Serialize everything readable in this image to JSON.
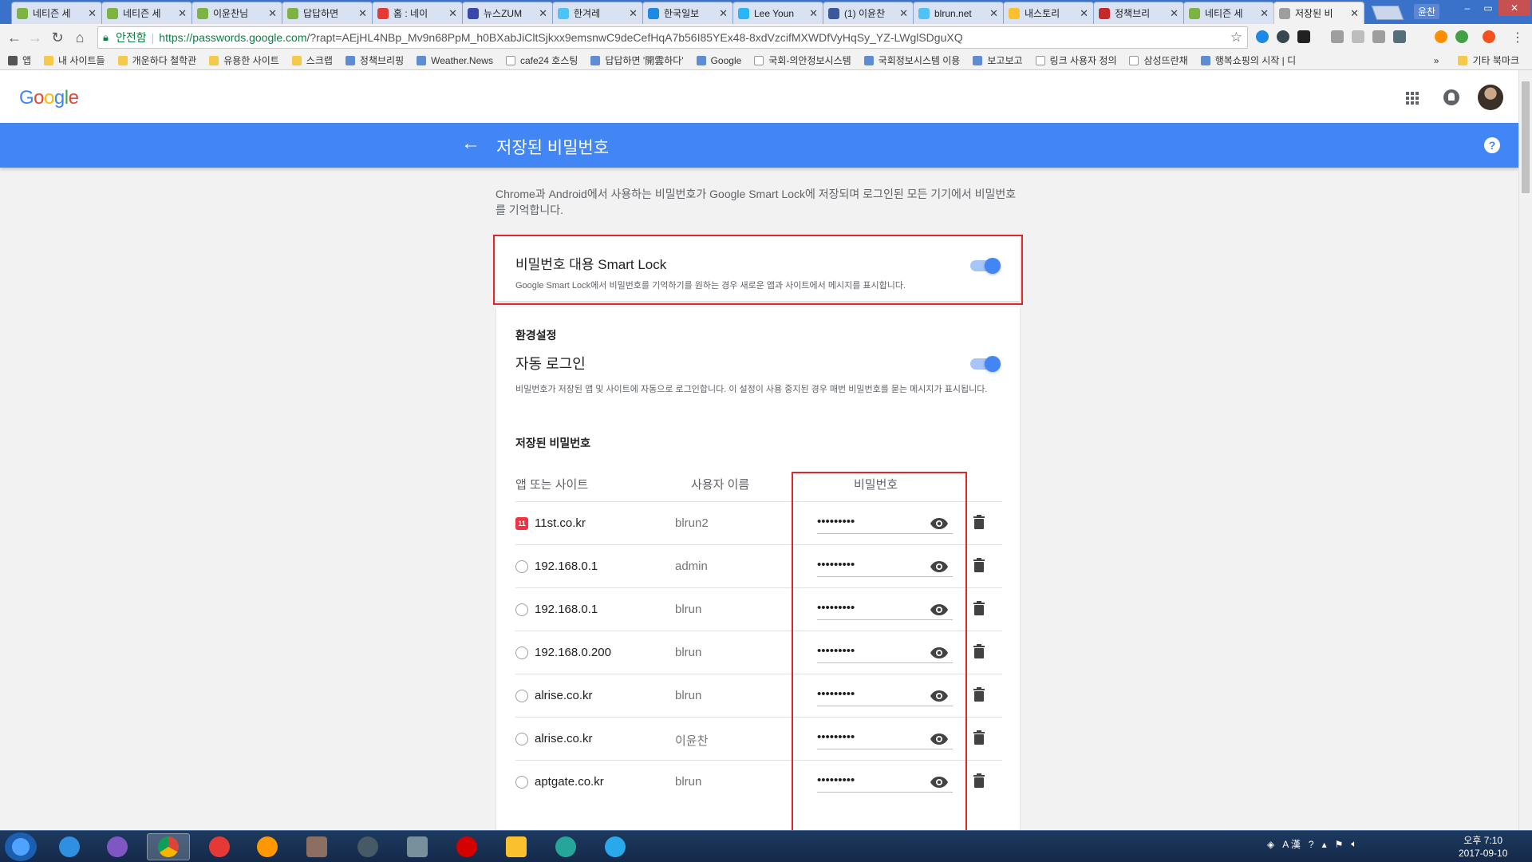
{
  "browser": {
    "tabs": [
      {
        "title": "네티즌 세",
        "icon_color": "#7cb342"
      },
      {
        "title": "네티즌 세",
        "icon_color": "#7cb342"
      },
      {
        "title": "이윤찬님",
        "icon_color": "#7cb342"
      },
      {
        "title": "답답하면",
        "icon_color": "#7cb342"
      },
      {
        "title": "홈 : 네이",
        "icon_color": "#e53935"
      },
      {
        "title": "뉴스ZUM",
        "icon_color": "#3949ab"
      },
      {
        "title": "한겨레",
        "icon_color": "#4fc3f7"
      },
      {
        "title": "한국일보",
        "icon_color": "#1e88e5"
      },
      {
        "title": "Lee Youn",
        "icon_color": "#29b6f6"
      },
      {
        "title": "(1) 이윤찬",
        "icon_color": "#3b5998"
      },
      {
        "title": "blrun.net",
        "icon_color": "#4fc3f7"
      },
      {
        "title": "내스토리",
        "icon_color": "#fbc02d"
      },
      {
        "title": "정책브리",
        "icon_color": "#c62828"
      },
      {
        "title": "네티즌 세",
        "icon_color": "#7cb342"
      },
      {
        "title": "저장된 비",
        "icon_color": "#9e9e9e"
      }
    ],
    "profile_name": "윤찬",
    "omnibox": {
      "security_label": "안전함",
      "url_host": "https://passwords.google.com",
      "url_path": "/?rapt=AEjHL4NBp_Mv9n68PpM_h0BXabJiCltSjkxx9emsnwC9deCefHqA7b56I85YEx48-8xdVzcifMXWDfVyHqSy_YZ-LWglSDguXQ"
    },
    "bookmarks": [
      {
        "label": "앱",
        "type": "apps"
      },
      {
        "label": "내 사이트들",
        "type": "folder"
      },
      {
        "label": "개운하다 철학관",
        "type": "folder"
      },
      {
        "label": "유용한 사이트",
        "type": "folder"
      },
      {
        "label": "스크랩",
        "type": "folder"
      },
      {
        "label": "정책브리핑",
        "type": "site"
      },
      {
        "label": "Weather.News",
        "type": "site"
      },
      {
        "label": "cafe24 호스팅",
        "type": "page"
      },
      {
        "label": "답답하면 '開雲하다'",
        "type": "site"
      },
      {
        "label": "Google",
        "type": "site"
      },
      {
        "label": "국회-의안정보시스템",
        "type": "page"
      },
      {
        "label": "국회정보시스템 이용",
        "type": "site"
      },
      {
        "label": "보고보고",
        "type": "site"
      },
      {
        "label": "링크 사용자 정의",
        "type": "page"
      },
      {
        "label": "삼성뜨란채",
        "type": "page"
      },
      {
        "label": "행복쇼핑의 시작 | 디",
        "type": "site"
      },
      {
        "label": "»",
        "type": "more"
      },
      {
        "label": "기타 북마크",
        "type": "folder"
      }
    ]
  },
  "page": {
    "logo": "Google",
    "title": "저장된 비밀번호",
    "intro": "Chrome과 Android에서 사용하는 비밀번호가 Google Smart Lock에 저장되며 로그인된 모든 기기에서 비밀번호를 기억합니다.",
    "smartlock": {
      "title": "비밀번호 대용 Smart Lock",
      "description": "Google Smart Lock에서 비밀번호를 기억하기를 원하는 경우 새로운 앱과 사이트에서 메시지를 표시합니다.",
      "enabled": true
    },
    "preferences": {
      "heading": "환경설정",
      "autologin_title": "자동 로그인",
      "autologin_desc": "비밀번호가 저장된 앱 및 사이트에 자동으로 로그인합니다. 이 설정이 사용 중지된 경우 매번 비밀번호를 묻는 메시지가 표시됩니다.",
      "autologin_enabled": true
    },
    "saved": {
      "heading": "저장된 비밀번호",
      "columns": {
        "site": "앱 또는 사이트",
        "user": "사용자 이름",
        "password": "비밀번호"
      },
      "rows": [
        {
          "site": "11st.co.kr",
          "user": "blrun2",
          "password": "•••••••••",
          "icon": "11st"
        },
        {
          "site": "192.168.0.1",
          "user": "admin",
          "password": "•••••••••",
          "icon": "globe"
        },
        {
          "site": "192.168.0.1",
          "user": "blrun",
          "password": "•••••••••",
          "icon": "globe"
        },
        {
          "site": "192.168.0.200",
          "user": "blrun",
          "password": "•••••••••",
          "icon": "globe"
        },
        {
          "site": "alrise.co.kr",
          "user": "blrun",
          "password": "•••••••••",
          "icon": "globe"
        },
        {
          "site": "alrise.co.kr",
          "user": "이윤찬",
          "password": "•••••••••",
          "icon": "globe"
        },
        {
          "site": "aptgate.co.kr",
          "user": "blrun",
          "password": "•••••••••",
          "icon": "globe"
        }
      ]
    }
  },
  "taskbar": {
    "clock_time": "오후 7:10",
    "clock_date": "2017-09-10",
    "ime_label": "A 漢"
  },
  "colors": {
    "accent": "#4285f4",
    "highlight": "#e0262a"
  }
}
